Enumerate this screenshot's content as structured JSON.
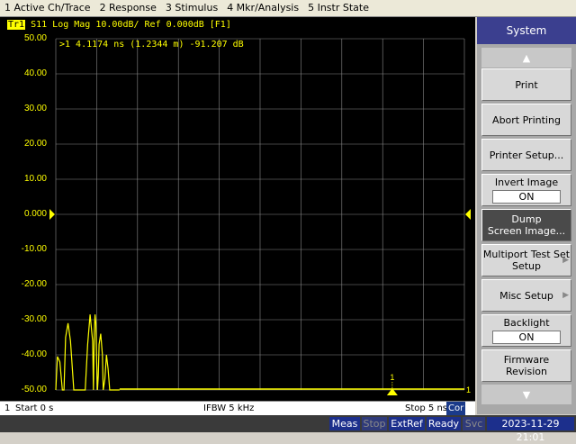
{
  "menu": [
    "1 Active Ch/Trace",
    "2 Response",
    "3 Stimulus",
    "4 Mkr/Analysis",
    "5 Instr State"
  ],
  "trace": {
    "tag": "Tr1",
    "header": "S11 Log Mag 10.00dB/ Ref 0.000dB [F1]",
    "marker_readout": ">1  4.1174 ns (1.2344 m) -91.207 dB",
    "marker_label": "1",
    "right_end_label": "1"
  },
  "axis": {
    "y_labels": [
      "50.00",
      "40.00",
      "30.00",
      "20.00",
      "10.00",
      "0.000",
      "-10.00",
      "-20.00",
      "-30.00",
      "-40.00",
      "-50.00"
    ]
  },
  "chart_data": {
    "type": "line",
    "title": "S11 Log Mag 10.00dB/ Ref 0.000dB [F1]",
    "ylim": [
      -50,
      50
    ],
    "xlim": [
      0,
      5
    ],
    "xunit": "ns",
    "ref_value": 0.0,
    "grid": true,
    "series": [
      {
        "name": "S11",
        "x": [
          0.0,
          0.02,
          0.05,
          0.08,
          0.1,
          0.12,
          0.15,
          0.18,
          0.22,
          0.25,
          0.28,
          0.3,
          0.33,
          0.36,
          0.39,
          0.42,
          0.45,
          0.46,
          0.47,
          0.48,
          0.49,
          0.5,
          0.51,
          0.52,
          0.53,
          0.55,
          0.57,
          0.58,
          0.6,
          0.62,
          0.64,
          0.66,
          0.68,
          0.7,
          0.72,
          0.74,
          0.76,
          0.78
        ],
        "y": [
          -50.0,
          -40.5,
          -42.0,
          -50.0,
          -50.0,
          -35.0,
          -31.0,
          -36.0,
          -50.0,
          -50.0,
          -50.0,
          -50.0,
          -50.0,
          -50.0,
          -37.0,
          -28.5,
          -36.0,
          -50.0,
          -34.0,
          -28.5,
          -31.0,
          -42.0,
          -50.0,
          -46.0,
          -37.0,
          -34.0,
          -40.0,
          -50.0,
          -47.0,
          -40.0,
          -44.0,
          -50.0,
          -50.0,
          -50.0,
          -50.0,
          -50.0,
          -50.0,
          -50.0
        ]
      }
    ],
    "marker": {
      "x": 4.1174,
      "y": -91.207
    }
  },
  "channel_status": {
    "channel": "1",
    "start": "Start 0 s",
    "ifbw": "IFBW 5 kHz",
    "stop": "Stop 5 ns",
    "cor": "Cor"
  },
  "instrument_status": {
    "meas": "Meas",
    "stop": "Stop",
    "extref": "ExtRef",
    "ready": "Ready",
    "svc": "Svc",
    "datetime": "2023-11-29 21:01"
  },
  "softkeys": {
    "title": "System",
    "print": "Print",
    "abort": "Abort Printing",
    "printer_setup": "Printer Setup...",
    "invert_image": "Invert Image",
    "invert_image_value": "ON",
    "dump_line1": "Dump",
    "dump_line2": "Screen Image...",
    "multiport_line1": "Multiport Test Set",
    "multiport_line2": "Setup",
    "misc_setup": "Misc Setup",
    "backlight": "Backlight",
    "backlight_value": "ON",
    "firmware_line1": "Firmware",
    "firmware_line2": "Revision"
  },
  "colors": {
    "trace": "#ffff00",
    "grid": "#8a8a8a",
    "status_blue": "#1c2f8c",
    "softkey_title": "#3b3f8f"
  }
}
